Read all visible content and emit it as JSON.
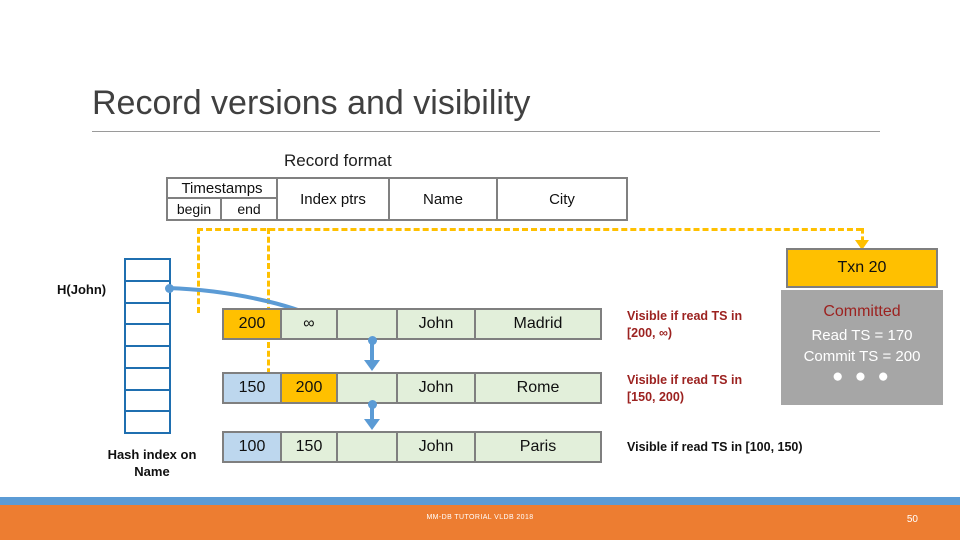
{
  "slide": {
    "title": "Record versions and visibility"
  },
  "record_format": {
    "heading": "Record format",
    "columns": [
      {
        "label": "Timestamps",
        "sub": [
          "begin",
          "end"
        ]
      },
      {
        "label": "Index ptrs"
      },
      {
        "label": "Name"
      },
      {
        "label": "City"
      }
    ]
  },
  "hash_index": {
    "pointer_label": "H(John)",
    "caption": "Hash index on Name",
    "cell_count": 8
  },
  "transaction": {
    "txn_label": "Txn 20",
    "status": "Committed",
    "read_ts_line": "Read TS = 170",
    "commit_ts_line": "Commit TS = 200",
    "ellipsis": "● ● ●"
  },
  "versions": [
    {
      "begin": "200",
      "end": "∞",
      "ptr": "",
      "name": "John",
      "city": "Madrid",
      "begin_fill": "amber",
      "end_fill": "green",
      "visible_line1": "Visible if read TS in",
      "visible_line2": "[200, ∞)"
    },
    {
      "begin": "150",
      "end": "200",
      "ptr": "",
      "name": "John",
      "city": "Rome",
      "begin_fill": "blue",
      "end_fill": "amber",
      "visible_line1": "Visible if read TS  in",
      "visible_line2": "[150, 200)"
    },
    {
      "begin": "100",
      "end": "150",
      "ptr": "",
      "name": "John",
      "city": "Paris",
      "begin_fill": "blue",
      "end_fill": "green",
      "visible_line1": "Visible if read TS  in [100, 150)",
      "visible_line2": ""
    }
  ],
  "footer": {
    "text": "MM-DB TUTORIAL VLDB 2018",
    "page_number": "50"
  },
  "colors": {
    "amber": "#FFC000",
    "light_blue": "#BDD7EE",
    "light_green": "#E2EFDA",
    "gray_box": "#A6A6A6",
    "accent_blue": "#5B9BD5",
    "index_blue": "#1F6FB0",
    "footer_orange": "#ED7D31",
    "dark_red": "#9C2220"
  }
}
